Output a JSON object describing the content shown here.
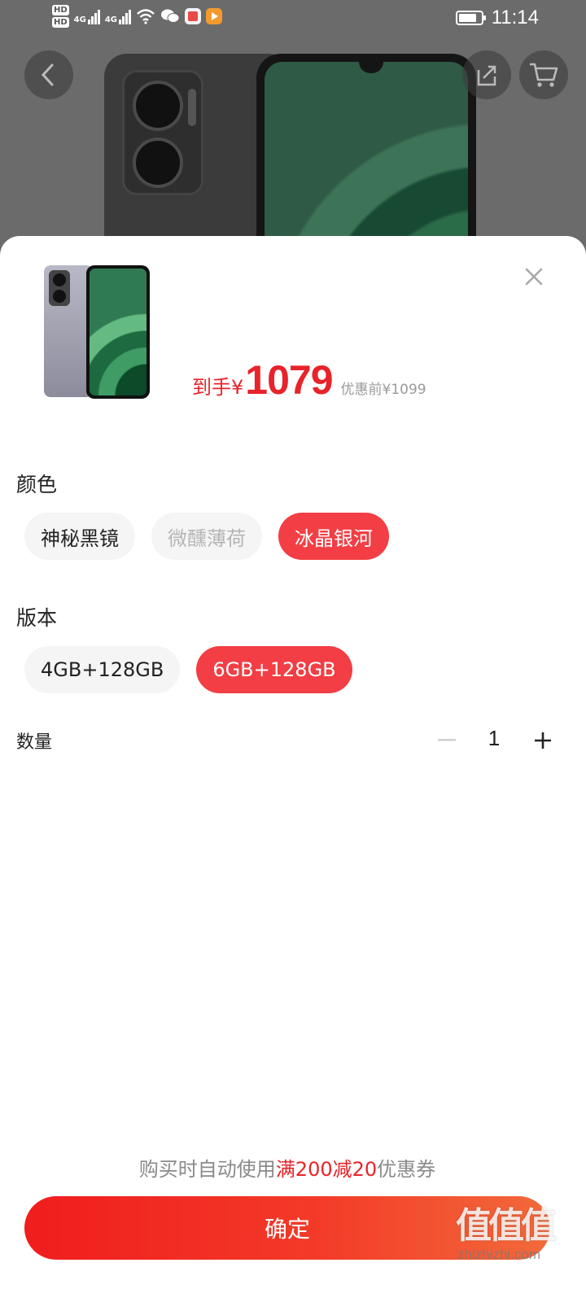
{
  "status_bar": {
    "time": "11:14",
    "hd1": "HD",
    "hd2": "HD",
    "net1": "4G",
    "net2": "4G",
    "icons": [
      "wifi-icon",
      "wechat-icon",
      "reader-app-icon",
      "video-app-icon",
      "battery-icon"
    ]
  },
  "background": {
    "nav_icons": [
      "back-icon",
      "share-icon",
      "cart-icon"
    ]
  },
  "sheet": {
    "price": {
      "prefix": "到手",
      "currency": "¥",
      "value": "1079",
      "original": "优惠前¥1099"
    },
    "color": {
      "title": "颜色",
      "options": [
        {
          "label": "神秘黑镜",
          "state": "normal"
        },
        {
          "label": "微醺薄荷",
          "state": "disabled"
        },
        {
          "label": "冰晶银河",
          "state": "selected"
        }
      ]
    },
    "version": {
      "title": "版本",
      "options": [
        {
          "label": "4GB+128GB",
          "state": "normal"
        },
        {
          "label": "6GB+128GB",
          "state": "selected"
        }
      ]
    },
    "quantity": {
      "label": "数量",
      "value": "1"
    },
    "coupon": {
      "prefix": "购买时自动使用",
      "highlight": "满200减20",
      "suffix": "优惠券"
    },
    "confirm_label": "确定"
  },
  "watermark": {
    "main": "值值值",
    "sub": "zhizhizhi.com"
  },
  "colors": {
    "accent": "#f23e44",
    "price_red": "#e8232a",
    "button_gradient_start": "#f01d1d",
    "button_gradient_end": "#f26a3a"
  }
}
